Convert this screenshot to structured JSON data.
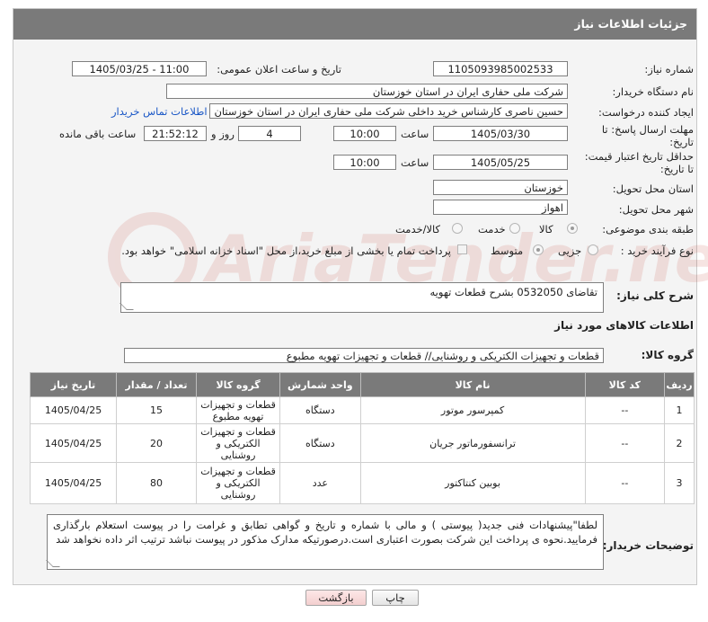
{
  "header": {
    "title": "جزئیات اطلاعات نیاز"
  },
  "fields": {
    "need_number_label": "شماره نیاز:",
    "need_number": "1105093985002533",
    "announce_label": "تاریخ و ساعت اعلان عمومی:",
    "announce_value": "1405/03/25 - 11:00",
    "buyer_org_label": "نام دستگاه خریدار:",
    "buyer_org": "شرکت ملی حفاری ایران در استان خوزستان",
    "requester_label": "ایجاد کننده درخواست:",
    "requester": "حسین ناصری کارشناس خرید داخلی شرکت ملی حفاری ایران در استان خوزستان",
    "contact_link": "اطلاعات تماس خریدار",
    "reply_deadline_label_1": "مهلت ارسال پاسخ: تا",
    "reply_deadline_label_2": "تاریخ:",
    "reply_date": "1405/03/30",
    "time_label": "ساعت",
    "reply_time": "10:00",
    "days_value": "4",
    "days_label": "روز و",
    "remaining_time": "21:52:12",
    "remaining_label": "ساعت باقی مانده",
    "price_validity_label_1": "حداقل تاریخ اعتبار قیمت:",
    "price_validity_label_2": "تا تاریخ:",
    "validity_date": "1405/05/25",
    "validity_time": "10:00",
    "province_label": "استان محل تحویل:",
    "province": "خوزستان",
    "city_label": "شهر محل تحویل:",
    "city": "اهواز",
    "category_label": "طبقه بندی موضوعی:",
    "category_options": [
      "کالا",
      "خدمت",
      "کالا/خدمت"
    ],
    "category_selected": "کالا",
    "process_label": "نوع فرآیند خرید :",
    "process_options": [
      "جزیی",
      "متوسط"
    ],
    "process_selected": "متوسط",
    "payment_note": "پرداخت تمام یا بخشی از مبلغ خرید،از محل \"اسناد خزانه اسلامی\" خواهد بود.",
    "summary_label": "شرح کلی نیاز:",
    "summary": "تقاضای 0532050 بشرح قطعات تهویه",
    "goods_section_title": "اطلاعات کالاهای مورد نیاز",
    "goods_group_label": "گروه کالا:",
    "goods_group": "قطعات و تجهیزات الکتریکی و روشنایی// قطعات و تجهیزات تهویه مطبوع"
  },
  "table": {
    "headers": [
      "ردیف",
      "کد کالا",
      "نام کالا",
      "واحد شمارش",
      "گروه کالا",
      "تعداد / مقدار",
      "تاریخ نیاز"
    ],
    "rows": [
      {
        "row": "1",
        "code": "--",
        "name": "کمپرسور موتور",
        "unit": "دستگاه",
        "group": "قطعات و تجهیزات تهویه مطبوع",
        "qty": "15",
        "date": "1405/04/25"
      },
      {
        "row": "2",
        "code": "--",
        "name": "ترانسفورماتور جریان",
        "unit": "دستگاه",
        "group": "قطعات و تجهیزات الکتریکی و روشنایی",
        "qty": "20",
        "date": "1405/04/25"
      },
      {
        "row": "3",
        "code": "--",
        "name": "بوبین کنتاکتور",
        "unit": "عدد",
        "group": "قطعات و تجهیزات الکتریکی و روشنایی",
        "qty": "80",
        "date": "1405/04/25"
      }
    ]
  },
  "buyer_notes_label": "توضیحات خریدار:",
  "buyer_notes": "لطفا\"پیشنهادات فنی جدید( پیوستی ) و مالی با شماره و تاریخ و گواهی تطابق و غرامت را در پیوست استعلام بارگذاری فرمایید.نحوه ی پرداخت این شرکت بصورت اعتباری است.درصورتیکه مدارک مذکور در پیوست نباشد ترتیب اثر داده نخواهد شد",
  "buttons": {
    "print": "چاپ",
    "back": "بازگشت"
  },
  "watermark": "AriaTender.net"
}
